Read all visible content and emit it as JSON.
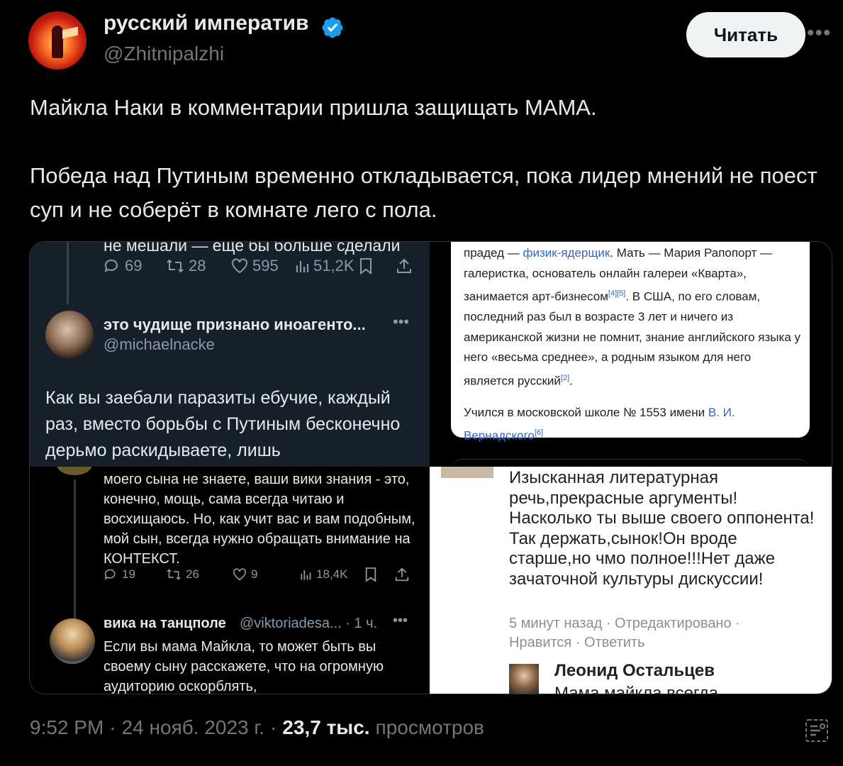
{
  "author": {
    "name": "русский императив",
    "handle": "@Zhitnipalzhi",
    "verified": true,
    "badge_color": "#1d9bf0"
  },
  "actions": {
    "read_label": "Читать",
    "more": "•••"
  },
  "tweet": {
    "paragraphs": [
      "Майкла Наки в комментарии пришла защищать МАМА.",
      "Победа над Путиным временно откладывается, пока лидер мнений не поест суп и не соберёт в комнате лего с пола."
    ]
  },
  "media": {
    "q1": {
      "cut_text": "не мешали — еще бы больше сделали",
      "stats": {
        "replies": "69",
        "reposts": "28",
        "likes": "595",
        "views": "51,2K"
      },
      "user_name": "это чудище признано иноагенто...",
      "user_handle": "@michaelnacke",
      "dots": "•••",
      "body": "Как вы заебали паразиты ебучие, каждый раз, вместо борьбы с Путиным бесконечно дерьмо раскидываете, лишь"
    },
    "q2": {
      "p1_a": "прадед — ",
      "p1_link": "физик-ядерщик",
      "p1_b": ". Мать — Мария Рапопорт — галеристка, основатель онлайн галереи «Кварта», занимается арт-бизнесом",
      "p1_sup1": "[4][5]",
      "p1_c": ". В США, по его словам, последний раз был в возрасте 3 лет и ничего из американской жизни не помнит, знание английского языка у него «весьма среднее», а родным языком для него является русский",
      "p1_sup2": "[2]",
      "p1_d": ".",
      "p2_a": "Учился в московской школе № 1553 имени ",
      "p2_link": "В. И. Вернадского",
      "p2_sup": "[6]",
      "p2_b": "."
    },
    "q3": {
      "body": "моего сына не знаете, ваши вики знания - это, конечно, мощь, сама всегда читаю и восхищаюсь. Но, как учит вас и вам подобным, мой сын, всегда нужно обращать внимание на КОНТЕКСТ.",
      "stats": {
        "replies": "19",
        "reposts": "26",
        "likes": "9",
        "views": "18,4K"
      },
      "reply_name": "вика на танцполе",
      "reply_handle": "@viktoriadesa... · 1 ч.",
      "dots": "•••",
      "reply_body": "Если вы мама Майкла, то может быть вы своему сыну расскажете, что на огромную аудиторию оскорблять,"
    },
    "q4": {
      "comment": "Изысканная литературная речь,прекрасные аргументы! Насколько ты выше своего оппонента!Так держать,сынок!Он вроде старше,но чмо полное!!!Нет даже зачаточной культуры дискуссии!",
      "meta_line1": "5 минут назад · Отредактировано ·",
      "meta_line2": "Нравится · Ответить",
      "next_name": "Леонид Остальцев",
      "next_cut": "Мама майкла всегда"
    }
  },
  "footer": {
    "time": "9:52 PM",
    "sep1": "·",
    "date": "24 нояб. 2023 г.",
    "sep2": "·",
    "views_count": "23,7 тыс.",
    "views_label": "просмотров"
  }
}
